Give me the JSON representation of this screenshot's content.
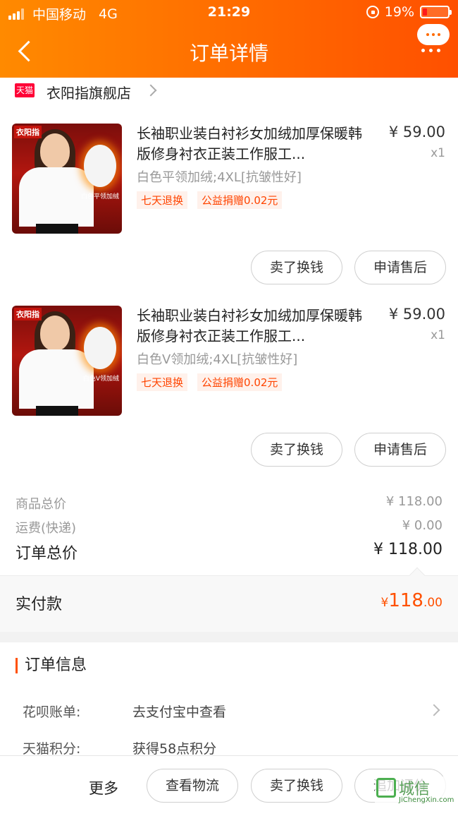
{
  "status_bar": {
    "carrier": "中国移动",
    "network": "4G",
    "time": "21:29",
    "battery": "19%"
  },
  "header": {
    "title": "订单详情"
  },
  "shop": {
    "badge": "天猫",
    "name": "衣阳指旗舰店"
  },
  "items": [
    {
      "name": "长袖职业装白衬衫女加绒加厚保暖韩版修身衬衣正装工作服工...",
      "sku": "白色平领加绒;4XL[抗皱性好]",
      "tags": [
        "七天退换",
        "公益捐赠0.02元"
      ],
      "price": "¥ 59.00",
      "qty": "x1",
      "thumb_brand": "衣阳指",
      "thumb_label": "白色平领加绒",
      "actions": [
        "卖了换钱",
        "申请售后"
      ]
    },
    {
      "name": "长袖职业装白衬衫女加绒加厚保暖韩版修身衬衣正装工作服工...",
      "sku": "白色V领加绒;4XL[抗皱性好]",
      "tags": [
        "七天退换",
        "公益捐赠0.02元"
      ],
      "price": "¥ 59.00",
      "qty": "x1",
      "thumb_brand": "衣阳指",
      "thumb_label": "白色V领加绒",
      "actions": [
        "卖了换钱",
        "申请售后"
      ]
    }
  ],
  "summary": {
    "goods_label": "商品总价",
    "goods_value": "¥ 118.00",
    "shipping_label": "运费(快递)",
    "shipping_value": "¥ 0.00",
    "total_label": "订单总价",
    "total_value": "¥ 118.00"
  },
  "paid": {
    "label": "实付款",
    "currency": "¥",
    "integer": "118",
    "decimal": ".00"
  },
  "order_info": {
    "title": "订单信息",
    "rows": [
      {
        "label": "花呗账单:",
        "value": "去支付宝中查看"
      },
      {
        "label": "天猫积分:",
        "value": "获得58点积分"
      }
    ]
  },
  "footer": {
    "more": "更多",
    "buttons": [
      "查看物流",
      "卖了换钱",
      "追加评价"
    ]
  },
  "watermark": {
    "text": "城信",
    "sub": "JiChengXin.com"
  },
  "colors": {
    "accent": "#ff5000",
    "header_gradient": "#ff8a00",
    "tag_bg": "#fff1eb",
    "tmall_red": "#ff0036"
  }
}
